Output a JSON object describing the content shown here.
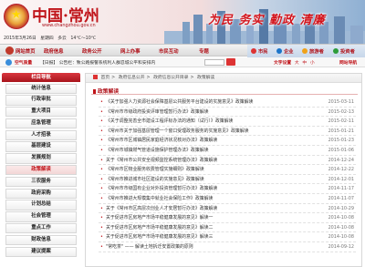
{
  "header": {
    "site_title": "中国·常州",
    "site_url": "www.changzhou.gov.cn",
    "slogan": "为民 务实 勤政 清廉",
    "date": "2015年3月26日",
    "weekday": "星期四",
    "weather": "多云",
    "temperature": "14℃～10℃"
  },
  "topnav": {
    "items": [
      {
        "label": "网站首页"
      },
      {
        "label": "政府信息"
      },
      {
        "label": "政务公开"
      },
      {
        "label": "网上办事"
      },
      {
        "label": "市民互动"
      },
      {
        "label": "专题"
      }
    ],
    "right_items": [
      {
        "label": "市民",
        "color": "#d33"
      },
      {
        "label": "企业",
        "color": "#1a74c9"
      },
      {
        "label": "旅游者",
        "color": "#f0a21a"
      },
      {
        "label": "投资者",
        "color": "#2b9c3a"
      }
    ]
  },
  "infobar": {
    "weather_label": "空气质量",
    "notice": "【日报】 公告栏：致公路报警系统利人群忍城公平和安排内",
    "search_value": "",
    "font_label": "文字设置",
    "font_sizes": [
      "大",
      "中",
      "小"
    ],
    "login_label": "网站导航"
  },
  "sidebar": {
    "heading": "栏目导航",
    "items": [
      {
        "label": "统计信息",
        "active": false
      },
      {
        "label": "行政审批",
        "active": false
      },
      {
        "label": "重大项目",
        "active": false
      },
      {
        "label": "应急管理",
        "active": false
      },
      {
        "label": "人才招录",
        "active": false
      },
      {
        "label": "基层建设",
        "active": false
      },
      {
        "label": "发展规划",
        "active": false
      },
      {
        "label": "政策解读",
        "active": true
      },
      {
        "label": "三农服务",
        "active": false
      },
      {
        "label": "政府采购",
        "active": false
      },
      {
        "label": "计划总结",
        "active": false
      },
      {
        "label": "社会管理",
        "active": false
      },
      {
        "label": "重点工作",
        "active": false
      },
      {
        "label": "财政信息",
        "active": false
      },
      {
        "label": "建议提案",
        "active": false
      }
    ]
  },
  "breadcrumb": {
    "items": [
      "首页",
      "政府信息公开",
      "政府信息公开目录",
      "政策解读"
    ]
  },
  "content": {
    "section_title": "政策解读",
    "articles": [
      {
        "title": "《关于加强人力资源社会保障基层公共服务平台建设的实施意见》政策解读",
        "date": "2015-03-11"
      },
      {
        "title": "《常州市市级政府投资评审管理暂行办法》政策解读",
        "date": "2015-02-13"
      },
      {
        "title": "《关于调整完善全市建设工程评标办法的通知（试行）》政策解读",
        "date": "2015-02-11"
      },
      {
        "title": "《常州市关于加强基层管理一个窗口受理政务服务的实施意见》政策解读",
        "date": "2015-01-21"
      },
      {
        "title": "《常州市市区城镇居民家庭经济状况核对办法》政策解读",
        "date": "2015-01-23"
      },
      {
        "title": "《常州市城镇燃气管道设施保护管理办法》政策解读",
        "date": "2015-01-06"
      },
      {
        "title": "关于《常州市公共安全视频监控系统管理办法》政策解读",
        "date": "2014-12-24"
      },
      {
        "title": "《常州市区物业服务收费管理实施细则》政策解读",
        "date": "2014-12-22"
      },
      {
        "title": "《常州市推进城市社区建设的实施意见》政策解读",
        "date": "2014-12-01"
      },
      {
        "title": "《常州市市级国有企业对外投资管理暂行办法》政策解读",
        "date": "2014-11-17"
      },
      {
        "title": "《常州市推进大规模集中就业社会保险工作》政策解读",
        "date": "2014-11-07"
      },
      {
        "title": "关于《常州市区高层次创业人才安居暂行办法》政策解读",
        "date": "2014-10-29"
      },
      {
        "title": "关于促进市区房地产市场平稳健康发展的意见》解读一",
        "date": "2014-10-08"
      },
      {
        "title": "关于促进市区房地产市场平稳健康发展的意见》解读二",
        "date": "2014-10-08"
      },
      {
        "title": "关于促进市区房地产市场平稳健康发展的意见》解读三",
        "date": "2014-10-08"
      },
      {
        "title": "\"常吃茶\" —— 解读土地拆迁安置政策的原则",
        "date": "2014-09-12"
      }
    ]
  },
  "colors": {
    "brand_red": "#c0141a",
    "nav_blue": "#c7d7ea"
  }
}
